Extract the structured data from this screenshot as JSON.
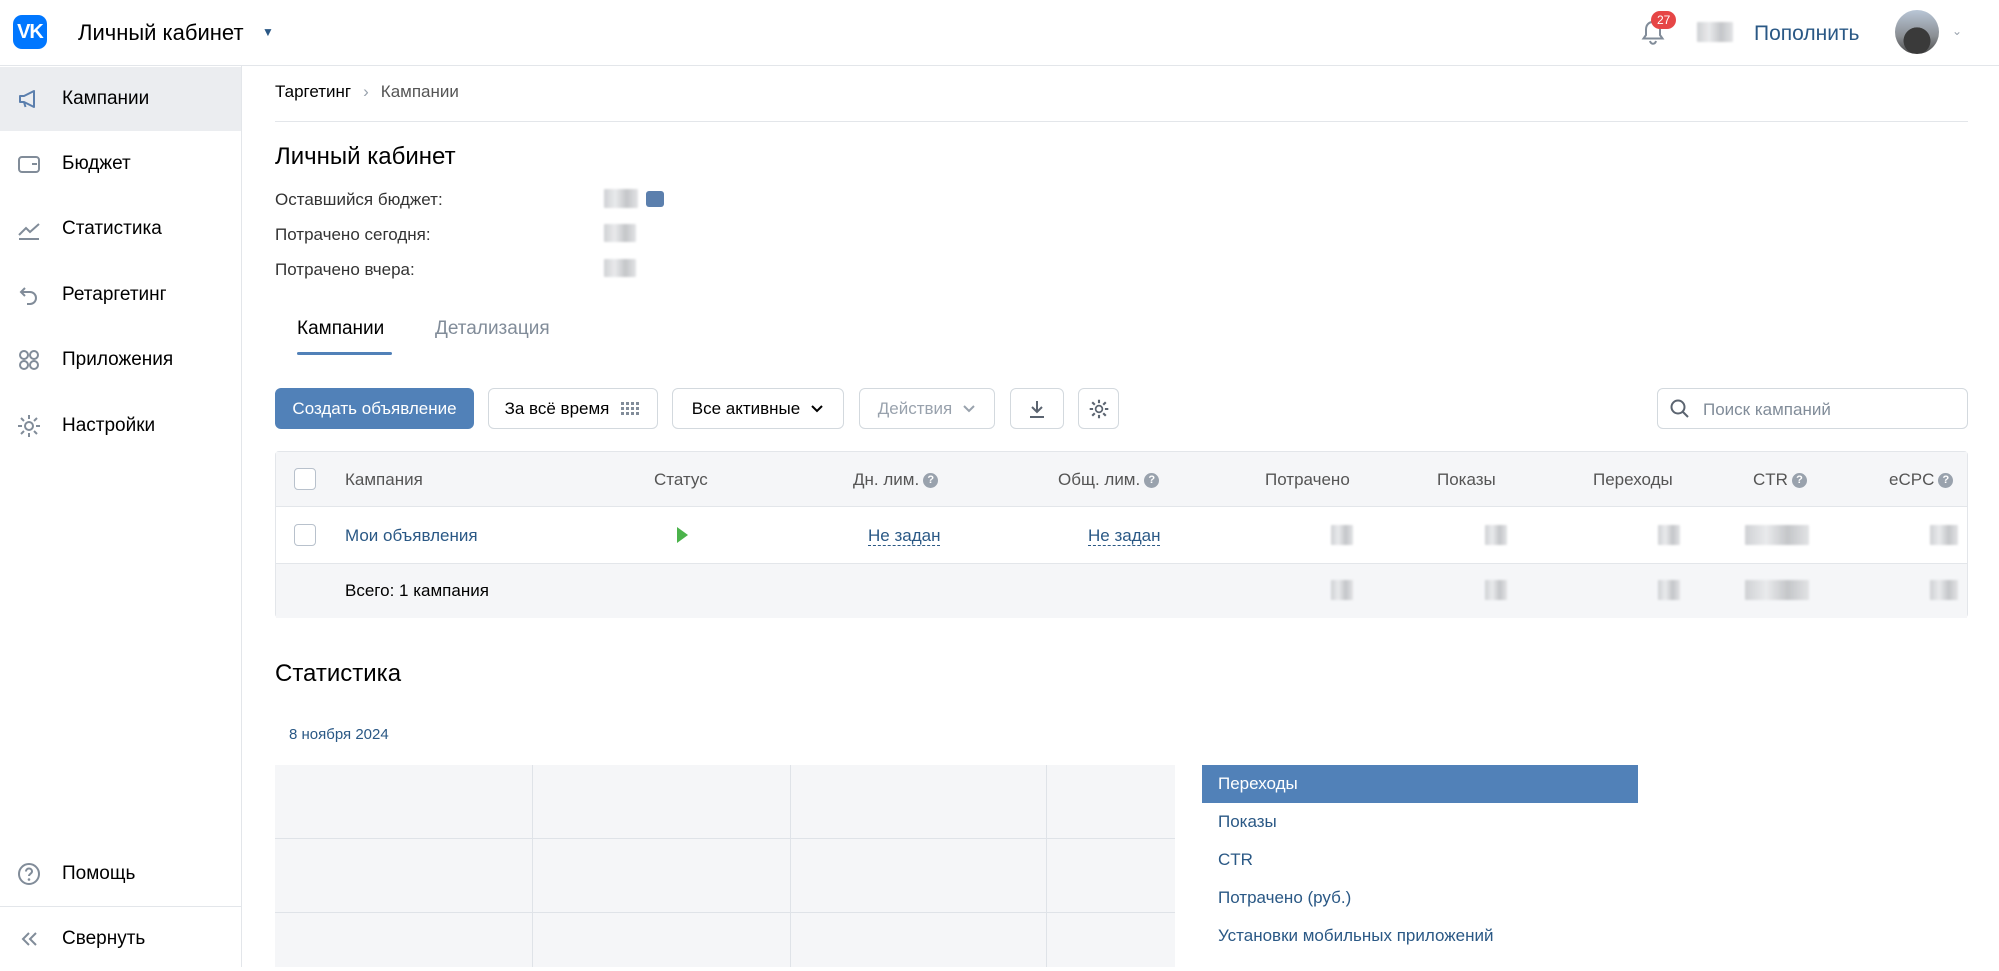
{
  "header": {
    "app_title": "Личный кабинет",
    "notifications_count": "27",
    "topup_label": "Пополнить"
  },
  "sidebar": {
    "items": [
      {
        "label": "Кампании",
        "icon": "megaphone-icon",
        "active": true
      },
      {
        "label": "Бюджет",
        "icon": "wallet-icon"
      },
      {
        "label": "Статистика",
        "icon": "chart-line-icon"
      },
      {
        "label": "Ретаргетинг",
        "icon": "return-arrow-icon"
      },
      {
        "label": "Приложения",
        "icon": "apps-grid-icon"
      },
      {
        "label": "Настройки",
        "icon": "gear-icon"
      }
    ],
    "help_label": "Помощь",
    "collapse_label": "Свернуть"
  },
  "breadcrumb": {
    "root": "Таргетинг",
    "current": "Кампании"
  },
  "account": {
    "title": "Личный кабинет",
    "budget_label": "Оставшийся бюджет:",
    "spent_today_label": "Потрачено сегодня:",
    "spent_yesterday_label": "Потрачено вчера:"
  },
  "tabs": [
    {
      "label": "Кампании",
      "active": true
    },
    {
      "label": "Детализация",
      "active": false
    }
  ],
  "toolbar": {
    "create_label": "Создать объявление",
    "period_label": "За всё время",
    "filter_label": "Все активные",
    "actions_label": "Действия",
    "search_placeholder": "Поиск кампаний"
  },
  "table": {
    "columns": [
      "Кампания",
      "Статус",
      "Дн. лим.",
      "Общ. лим.",
      "Потрачено",
      "Показы",
      "Переходы",
      "CTR",
      "eCPC"
    ],
    "rows": [
      {
        "name": "Мои объявления",
        "status": "running",
        "daily_limit": "Не задан",
        "total_limit": "Не задан"
      }
    ],
    "total_label": "Всего: 1 кампания"
  },
  "stats": {
    "title": "Статистика",
    "date": "8 ноября 2024",
    "metrics": [
      "Переходы",
      "Показы",
      "CTR",
      "Потрачено (руб.)",
      "Установки мобильных приложений"
    ],
    "selected_metric": "Переходы"
  },
  "colors": {
    "accent": "#5181b8",
    "link": "#2a5885",
    "vk_blue": "#0077ff",
    "badge": "#e64646",
    "play": "#4bb34b"
  }
}
